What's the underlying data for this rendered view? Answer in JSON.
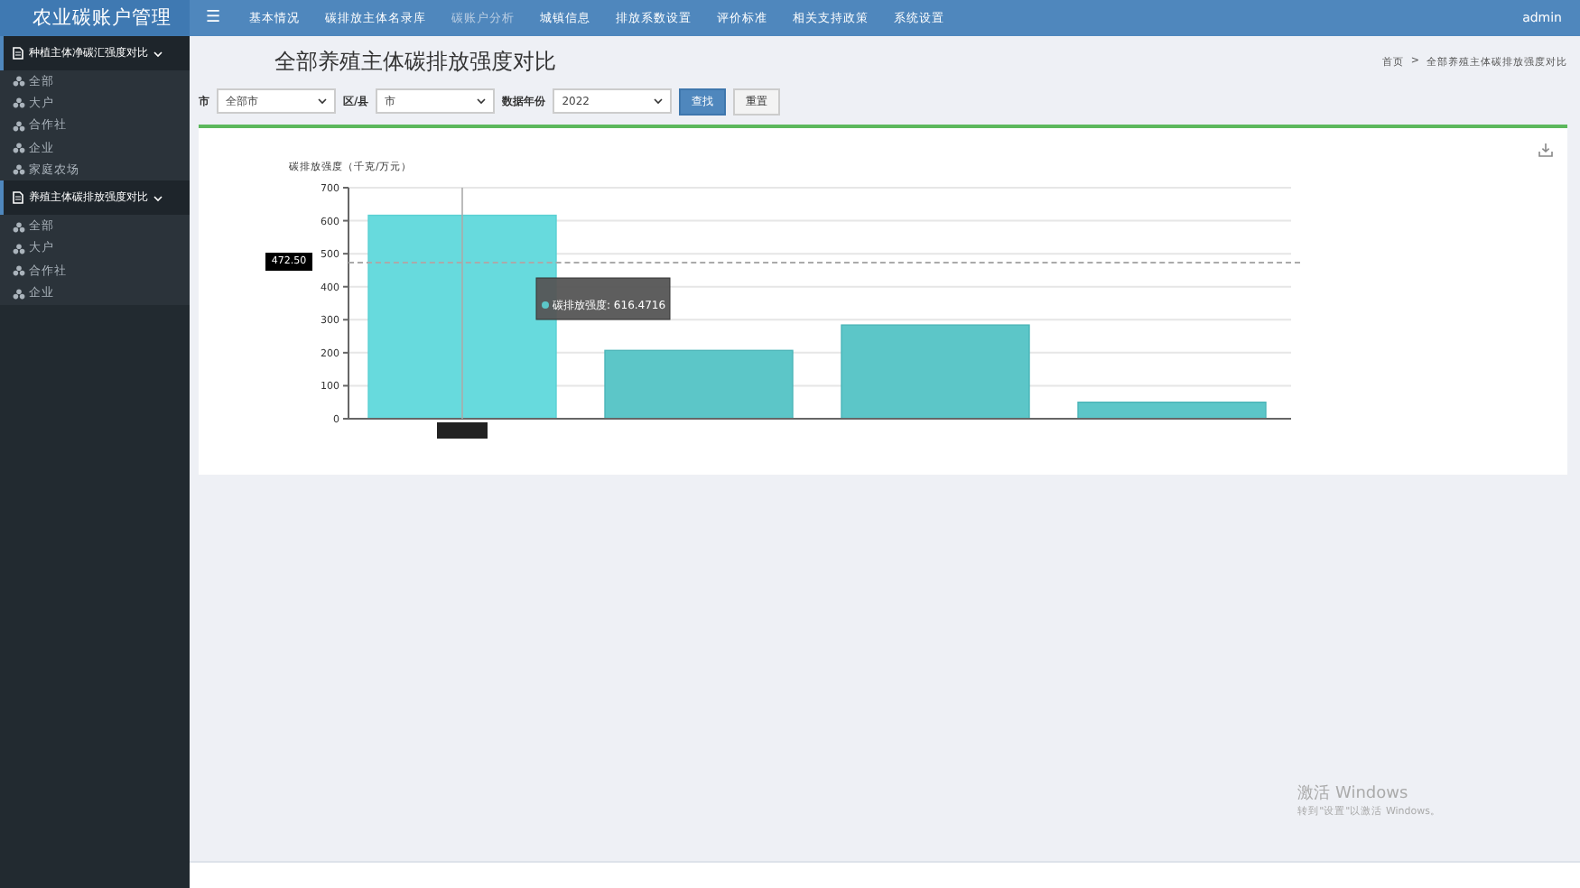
{
  "brand": "农业碳账户管理",
  "menu_icon": "☰",
  "breadcrumb_separator": ">",
  "nav": [
    {
      "label": "基本情况",
      "selected": false
    },
    {
      "label": "碳排放主体名录库",
      "selected": false
    },
    {
      "label": "碳账户分析",
      "selected": true
    },
    {
      "label": "城镇信息",
      "selected": false
    },
    {
      "label": "排放系数设置",
      "selected": false
    },
    {
      "label": "评价标准",
      "selected": false
    },
    {
      "label": "相关支持政策",
      "selected": false
    },
    {
      "label": "系统设置",
      "selected": false
    }
  ],
  "user": "admin",
  "sidebar": [
    {
      "label": "种植主体净碳汇强度对比",
      "expanded": true,
      "children": [
        {
          "label": "全部"
        },
        {
          "label": "大户"
        },
        {
          "label": "合作社"
        },
        {
          "label": "企业"
        },
        {
          "label": "家庭农场"
        }
      ]
    },
    {
      "label": "养殖主体碳排放强度对比",
      "expanded": true,
      "children": [
        {
          "label": "全部"
        },
        {
          "label": "大户"
        },
        {
          "label": "合作社"
        },
        {
          "label": "企业"
        }
      ]
    }
  ],
  "page_title": "全部养殖主体碳排放强度对比",
  "breadcrumb": [
    "首页",
    "全部养殖主体碳排放强度对比"
  ],
  "filters": [
    {
      "label": "市",
      "value": "全部市"
    },
    {
      "label": "区/县",
      "value": "市"
    },
    {
      "label": "数据年份",
      "value": "2022"
    }
  ],
  "buttons": [
    {
      "label": "查找",
      "kind": "primary"
    },
    {
      "label": "重置",
      "kind": "default"
    }
  ],
  "chart": {
    "tooltip": "碳排放强度: 616.4716",
    "pointer_label": "472.50",
    "chart_data": {
      "type": "bar",
      "ylabel": "碳排放强度（千克/万元）",
      "ylim": [
        0,
        700
      ],
      "yticks": [
        0,
        100,
        200,
        300,
        400,
        500,
        600,
        700
      ],
      "grid": true,
      "series": [
        {
          "color": "#5cc6c8",
          "values": [
            616.4716,
            207,
            284,
            50
          ]
        }
      ]
    }
  },
  "activation": {
    "title": "激活 Windows",
    "text": "转到\"设置\"以激活 Windows。"
  }
}
